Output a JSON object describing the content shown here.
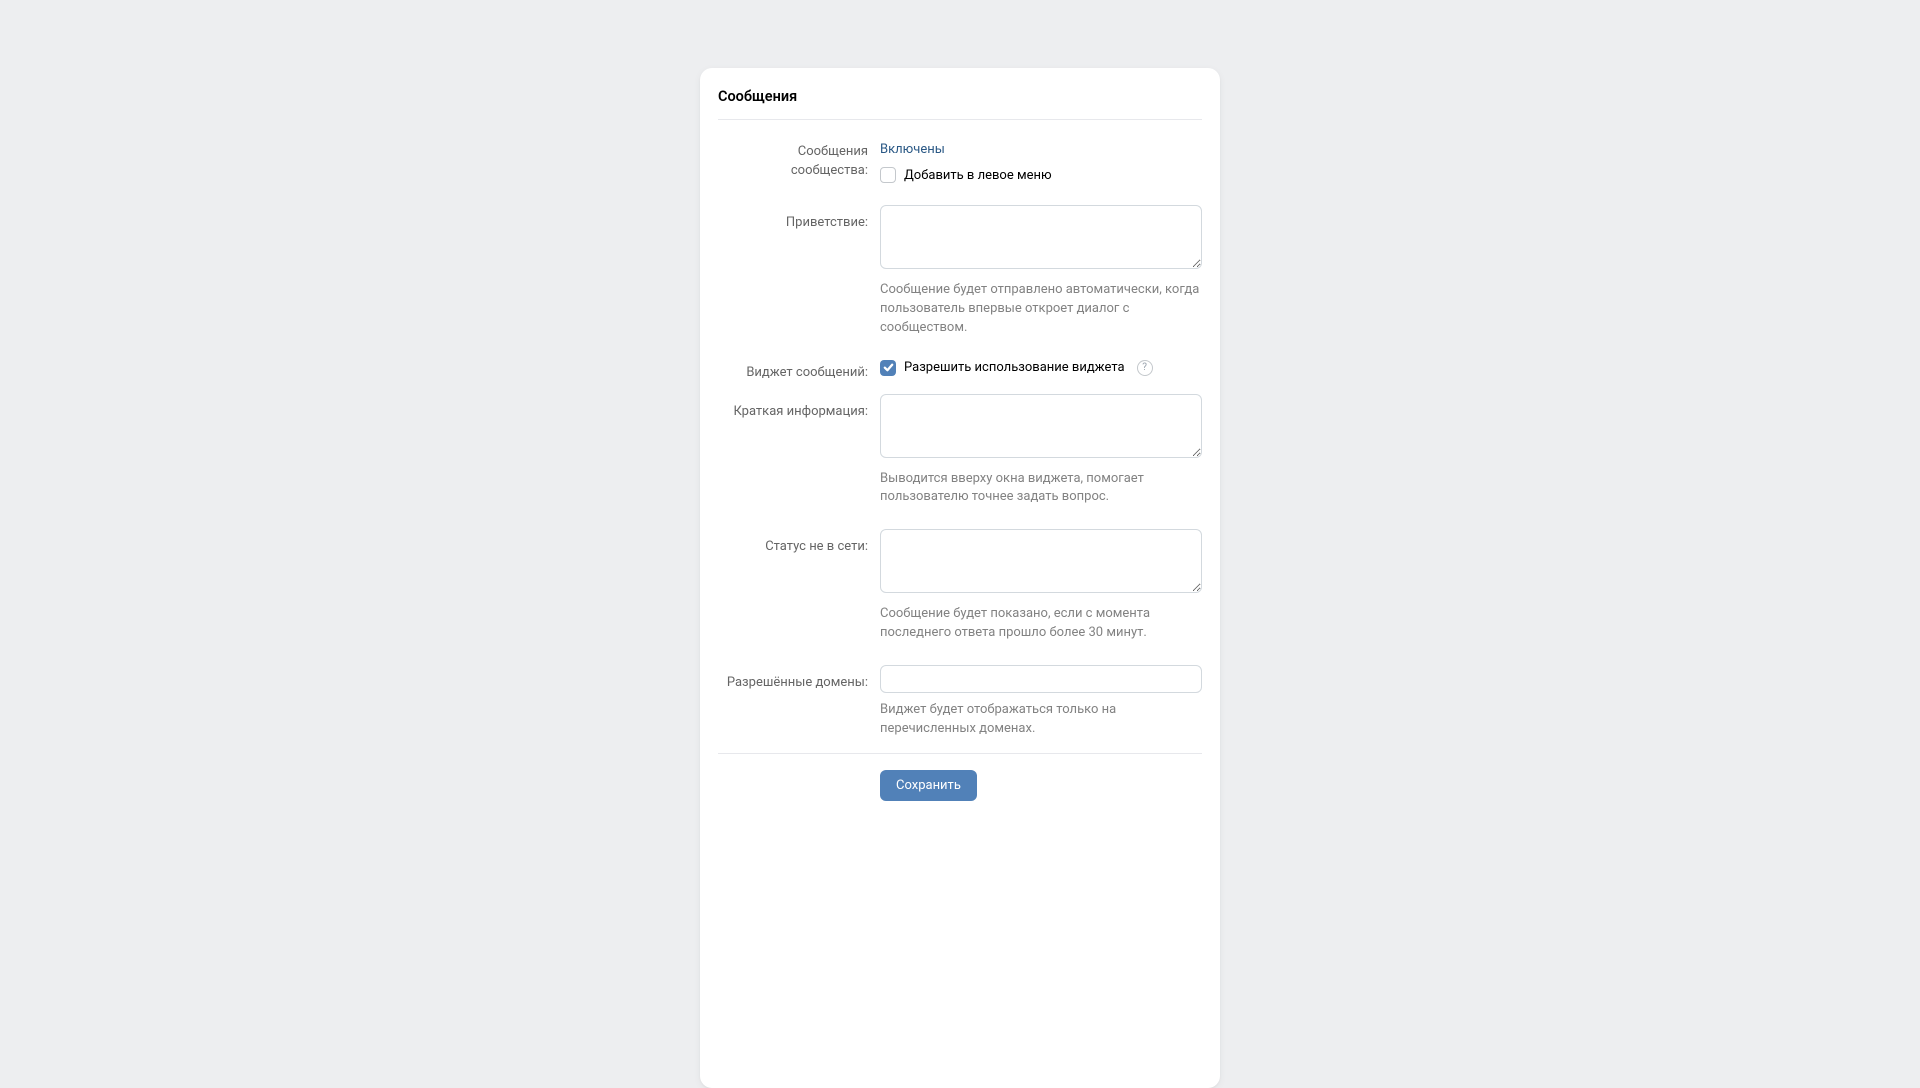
{
  "panel": {
    "title": "Сообщения"
  },
  "form": {
    "community_messages": {
      "label": "Сообщения сообщества:",
      "value": "Включены",
      "add_to_left_menu_label": "Добавить в левое меню",
      "add_to_left_menu_checked": false
    },
    "greeting": {
      "label": "Приветствие:",
      "value": "",
      "helper": "Сообщение будет отправлено автоматически, когда пользователь впервые откроет диалог с сообществом."
    },
    "widget": {
      "label": "Виджет сообщений:",
      "allow_label": "Разрешить использование виджета",
      "allow_checked": true,
      "help_symbol": "?"
    },
    "short_info": {
      "label": "Краткая информация:",
      "value": "",
      "helper": "Выводится вверху окна виджета, помогает пользователю точнее задать вопрос."
    },
    "offline_status": {
      "label": "Статус не в сети:",
      "value": "",
      "helper": "Сообщение будет показано, если с момента последнего ответа прошло более 30 минут."
    },
    "allowed_domains": {
      "label": "Разрешённые домены:",
      "value": "",
      "helper": "Виджет будет отображаться только на перечисленных доменах."
    },
    "save_button": "Сохранить"
  }
}
